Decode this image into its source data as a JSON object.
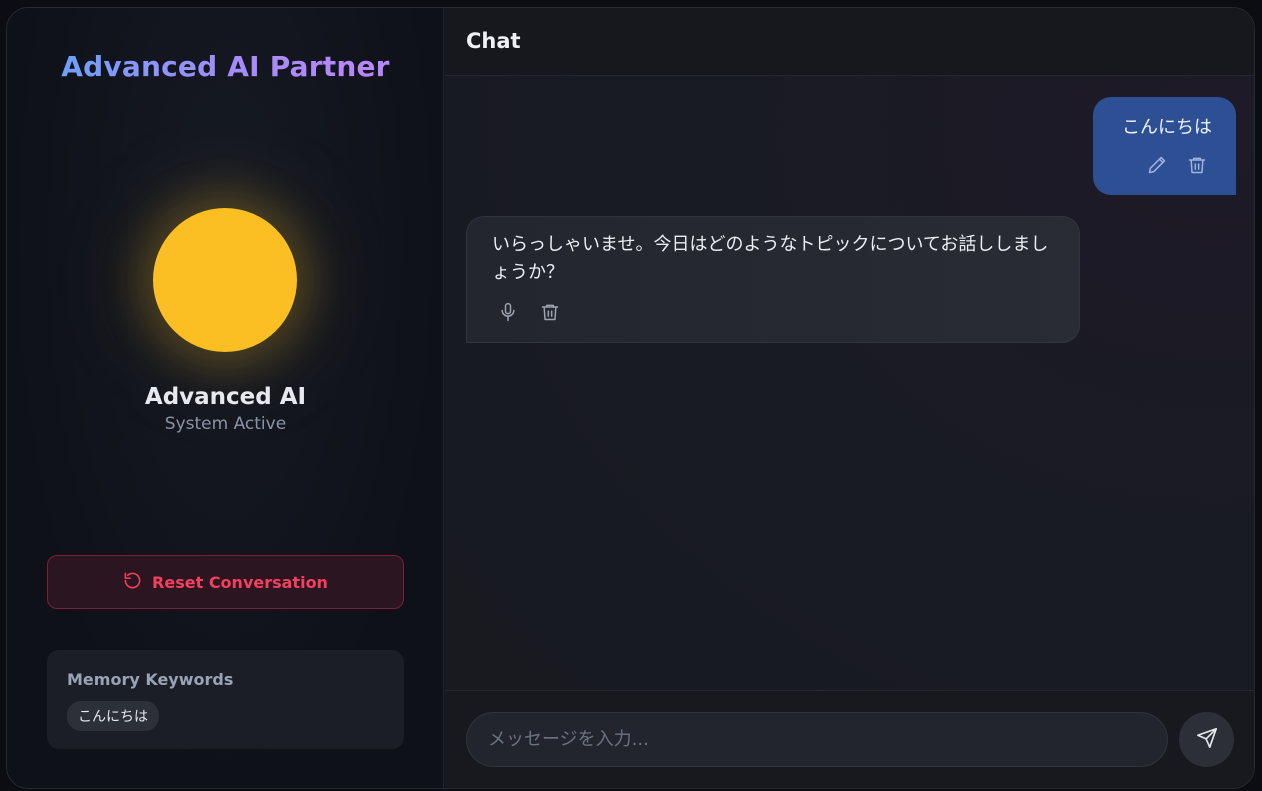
{
  "sidebar": {
    "brand_title": "Advanced AI Partner",
    "ai_name": "Advanced AI",
    "ai_status": "System Active",
    "orb_color": "#fbbf24",
    "reset_label": "Reset Conversation",
    "memory": {
      "title": "Memory Keywords",
      "keywords": [
        "こんにちは"
      ]
    }
  },
  "chat": {
    "title": "Chat",
    "messages": [
      {
        "role": "user",
        "text": "こんにちは",
        "actions": [
          "edit-icon",
          "trash-icon"
        ]
      },
      {
        "role": "assistant",
        "text": "いらっしゃいませ。今日はどのようなトピックについてお話ししましょうか？",
        "actions": [
          "microphone-icon",
          "trash-icon"
        ]
      }
    ],
    "input_placeholder": "メッセージを入力...",
    "input_value": ""
  },
  "colors": {
    "accent_blue": "#2d4f93",
    "danger": "#f43f5e",
    "brand_gradient_start": "#60a5fa",
    "brand_gradient_end": "#c084fc"
  }
}
